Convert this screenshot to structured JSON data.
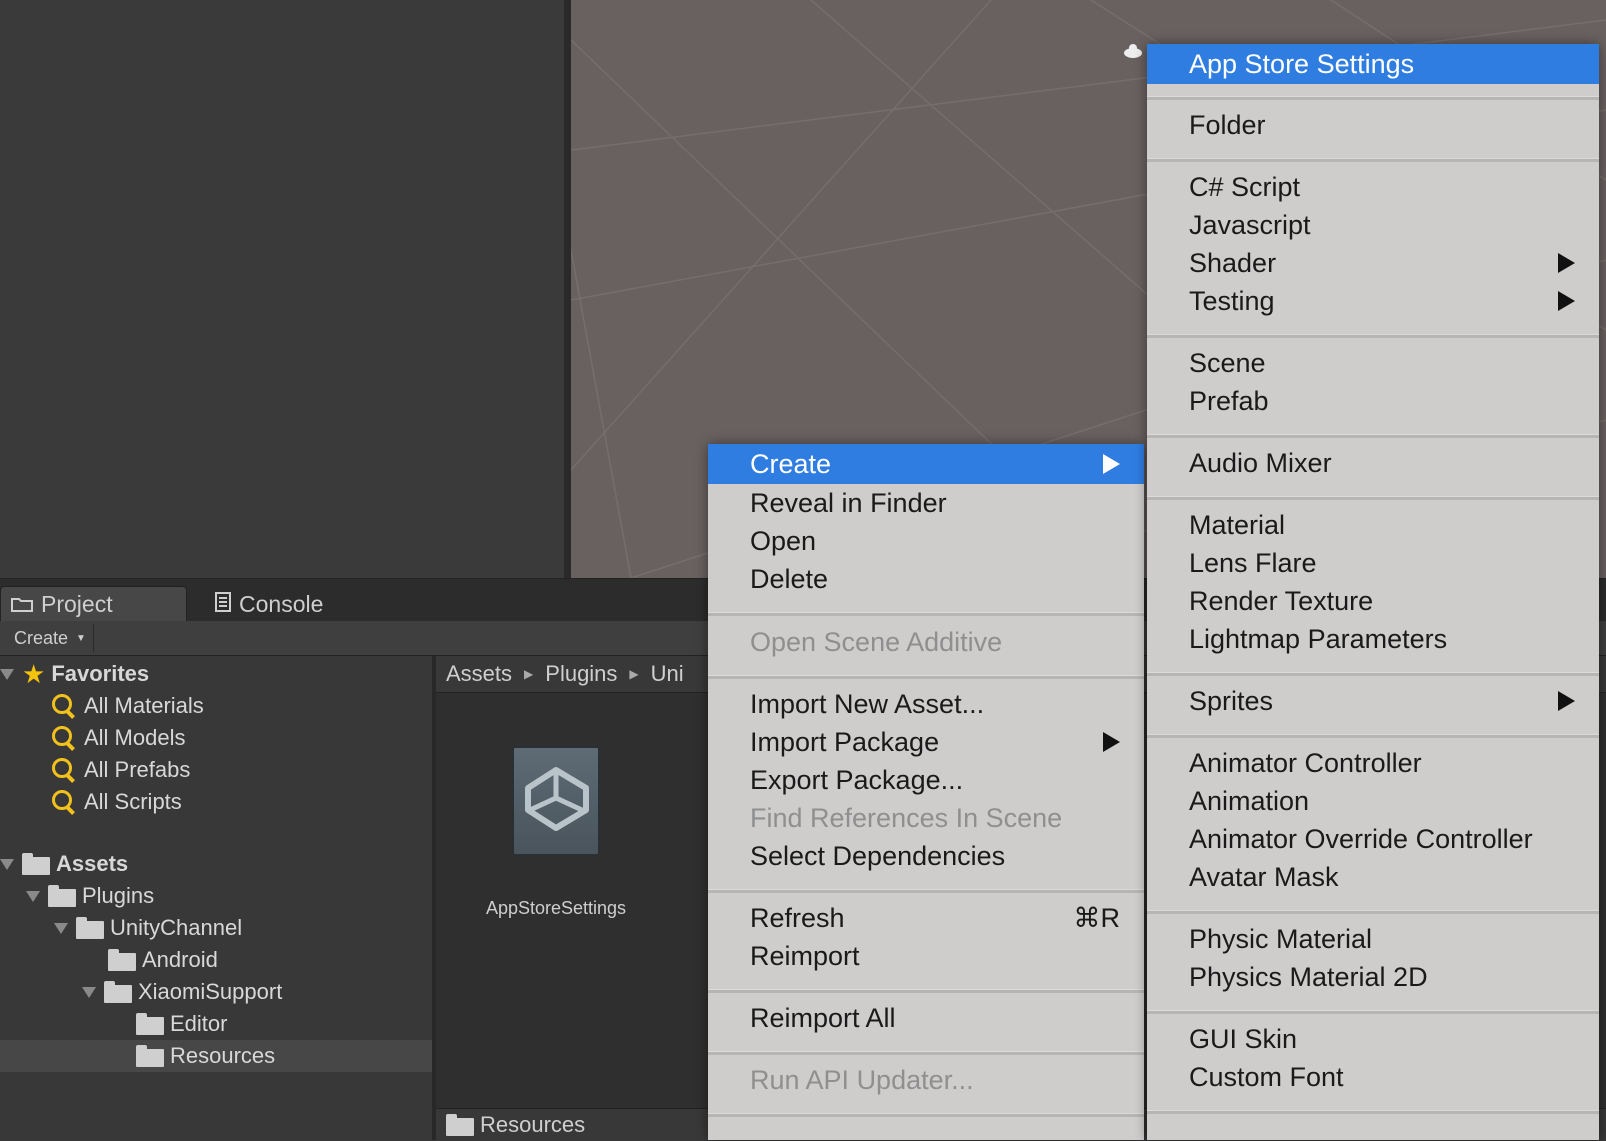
{
  "tabs": [
    {
      "label": "Project",
      "icon": "folder-icon"
    },
    {
      "label": "Console",
      "icon": "console-icon"
    }
  ],
  "toolbar": {
    "create_label": "Create"
  },
  "tree": {
    "favorites": {
      "label": "Favorites",
      "items": [
        "All Materials",
        "All Models",
        "All Prefabs",
        "All Scripts"
      ]
    },
    "assets": {
      "label": "Assets",
      "children": [
        {
          "label": "Plugins"
        },
        {
          "label": "UnityChannel"
        },
        {
          "label": "Android"
        },
        {
          "label": "XiaomiSupport"
        },
        {
          "label": "Editor"
        },
        {
          "label": "Resources",
          "selected": true
        }
      ]
    }
  },
  "breadcrumb": [
    "Assets",
    "Plugins",
    "Uni"
  ],
  "asset": {
    "name": "AppStoreSettings"
  },
  "footer": {
    "path": "Resources"
  },
  "context_menu": {
    "items": [
      {
        "label": "Create",
        "highlighted": true,
        "submenu": true
      },
      {
        "label": "Reveal in Finder"
      },
      {
        "label": "Open"
      },
      {
        "label": "Delete"
      },
      {
        "label": "Open Scene Additive",
        "disabled": true
      },
      {
        "label": "Import New Asset..."
      },
      {
        "label": "Import Package",
        "submenu": true
      },
      {
        "label": "Export Package..."
      },
      {
        "label": "Find References In Scene",
        "disabled": true
      },
      {
        "label": "Select Dependencies"
      },
      {
        "label": "Refresh",
        "shortcut": "⌘R"
      },
      {
        "label": "Reimport"
      },
      {
        "label": "Reimport All"
      },
      {
        "label": "Run API Updater...",
        "disabled": true
      }
    ]
  },
  "create_submenu": {
    "items": [
      {
        "label": "App Store Settings",
        "highlighted": true
      },
      {
        "label": "Folder"
      },
      {
        "label": "C# Script"
      },
      {
        "label": "Javascript"
      },
      {
        "label": "Shader",
        "submenu": true
      },
      {
        "label": "Testing",
        "submenu": true
      },
      {
        "label": "Scene"
      },
      {
        "label": "Prefab"
      },
      {
        "label": "Audio Mixer"
      },
      {
        "label": "Material"
      },
      {
        "label": "Lens Flare"
      },
      {
        "label": "Render Texture"
      },
      {
        "label": "Lightmap Parameters"
      },
      {
        "label": "Sprites",
        "submenu": true
      },
      {
        "label": "Animator Controller"
      },
      {
        "label": "Animation"
      },
      {
        "label": "Animator Override Controller"
      },
      {
        "label": "Avatar Mask"
      },
      {
        "label": "Physic Material"
      },
      {
        "label": "Physics Material 2D"
      },
      {
        "label": "GUI Skin"
      },
      {
        "label": "Custom Font"
      }
    ]
  },
  "colors": {
    "highlight": "#2f7de1",
    "menu_bg": "#cfcdcc",
    "favorite_star": "#f5c30b",
    "search_icon": "#f2c11c"
  }
}
